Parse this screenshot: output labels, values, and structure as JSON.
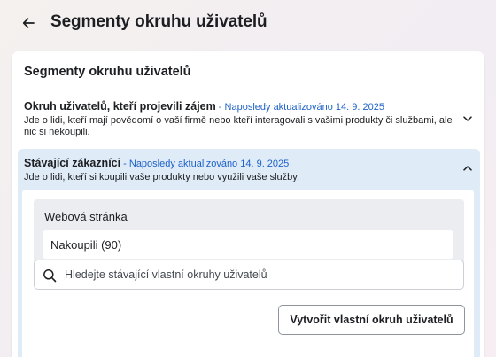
{
  "header": {
    "back_icon": "arrow-left-icon",
    "title": "Segmenty okruhu uživatelů"
  },
  "card": {
    "title": "Segmenty okruhu uživatelů"
  },
  "segments": [
    {
      "name": "Okruh uživatelů, kteří projevili zájem",
      "separator": " - ",
      "updated": "Naposledy aktualizováno 14. 9. 2025",
      "description": "Jde o lidi, kteří mají povědomí o vaší firmě nebo kteří interagovali s vašimi produkty či službami, ale nic si nekoupili.",
      "expanded": false,
      "chevron_icon": "chevron-down-icon"
    },
    {
      "name": "Stávající zákazníci",
      "separator": " - ",
      "updated": "Naposledy aktualizováno 14. 9. 2025",
      "description": "Jde o lidi, kteří si koupili vaše produkty nebo využili vaše služby.",
      "expanded": true,
      "chevron_icon": "chevron-up-icon"
    }
  ],
  "customers_panel": {
    "source_label": "Webová stránka",
    "source_item": "Nakoupili (90)",
    "search_placeholder": "Hledejte stávající vlastní okruhy uživatelů",
    "search_value": "",
    "create_button": "Vytvořit vlastní okruh uživatelů"
  },
  "colors": {
    "accent_link": "#1d62c7",
    "expanded_bg": "#dfebf7",
    "source_bg": "#ebedf0"
  }
}
